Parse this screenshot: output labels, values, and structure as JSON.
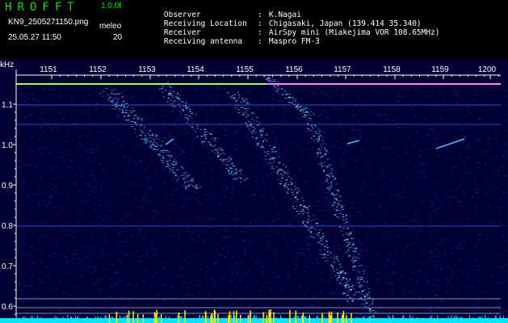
{
  "header": {
    "brand": "HROFFT",
    "version": "1.0.0f",
    "filename": "KN9_2505271150.png",
    "meleo_label": "meleo",
    "datetime": "25.05.27 11:50",
    "meleo_value": "20",
    "info": [
      {
        "key": "Observer",
        "sep": ":",
        "value": "K.Nagai"
      },
      {
        "key": "Receiving Location",
        "sep": ":",
        "value": "Chigasaki, Japan (139.414 35.340)"
      },
      {
        "key": "Receiver",
        "sep": ":",
        "value": "AirSpy mini (Miakejima VOR 108.65MHz)"
      },
      {
        "key": "Receiving antenna",
        "sep": ":",
        "value": "Maspro FM-3"
      }
    ]
  },
  "chart_data": {
    "type": "heatmap",
    "x_unit": "time (hhmm)",
    "x_ticks": [
      "1151",
      "1152",
      "1153",
      "1154",
      "1155",
      "1156",
      "1157",
      "1158",
      "1159",
      "1200"
    ],
    "y_unit": "kHz",
    "y_ticks": [
      "0.6",
      "0.7",
      "0.8",
      "0.9",
      "1.0",
      "1.1"
    ],
    "y_range": [
      0.58,
      1.2
    ],
    "colors": {
      "background": "#000033",
      "noise": "#0c1a8c",
      "signal": "#5ab4ff",
      "strong": "#e0ffff",
      "carrier": "#a0ff60",
      "carrier_right": "#ff80ff",
      "axis": "#ffffff",
      "tick_label": "#ffffff",
      "bottom_bar": "#00e5ff",
      "bottom_spikes": "#ffee00"
    }
  }
}
